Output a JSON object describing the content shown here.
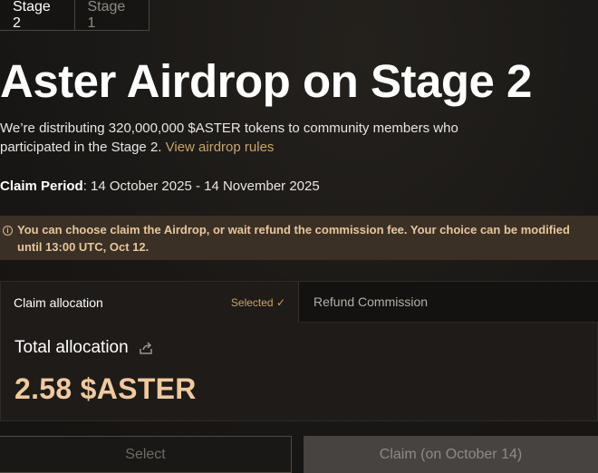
{
  "stage_tabs": [
    {
      "label": "Stage 2",
      "active": true
    },
    {
      "label": "Stage 1",
      "active": false
    }
  ],
  "page_title": "Aster Airdrop on Stage 2",
  "description": {
    "text": "We’re distributing 320,000,000 $ASTER tokens to community members who participated in the Stage 2.",
    "link": "View airdrop rules"
  },
  "claim_period": {
    "label": "Claim Period",
    "value": ": 14 October 2025 - 14 November 2025"
  },
  "notice": {
    "icon": "info-icon",
    "text": "You can choose claim the Airdrop, or wait refund the commission fee. Your choice can be modified until 13:00 UTC, Oct 12."
  },
  "options": {
    "claim": {
      "label": "Claim allocation",
      "status": "Selected ✓"
    },
    "refund": {
      "label": "Refund Commission"
    }
  },
  "allocation": {
    "label": "Total allocation",
    "value": "2.58 $ASTER",
    "icon": "share-icon"
  },
  "buttons": {
    "select": "Select",
    "claim": "Claim (on October 14)"
  },
  "colors": {
    "accent": "#c9a36b",
    "allocation_value": "#f0c9a0",
    "notice_bg": "#3b3026",
    "background": "#1a1816"
  }
}
